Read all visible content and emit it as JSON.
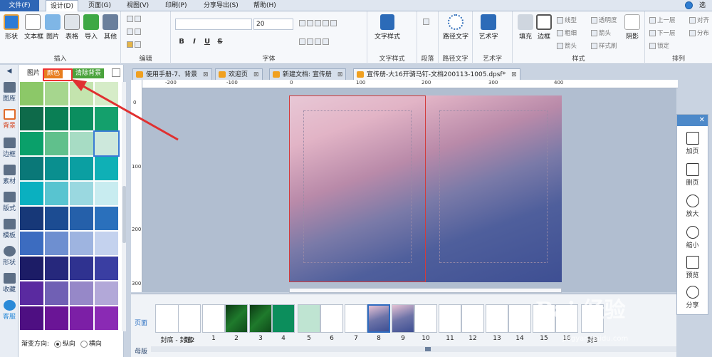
{
  "menu": {
    "file": "文件(F)",
    "items": [
      "设计(D)",
      "页面(G)",
      "视图(V)",
      "印刷(P)",
      "分享导出(S)",
      "帮助(H)"
    ],
    "right": "选项"
  },
  "ribbon": {
    "insert": {
      "buttons": [
        "形状",
        "文本框",
        "图片",
        "表格",
        "导入",
        "其他"
      ],
      "label": "插入"
    },
    "edit": {
      "label": "编辑"
    },
    "font": {
      "size": "20",
      "label": "字体"
    },
    "text_style": {
      "button": "文字样式",
      "label": "文字样式"
    },
    "paragraph": {
      "label": "段落"
    },
    "path_text": {
      "button": "路径文字",
      "label": "路径文字"
    },
    "art_text": {
      "button": "艺术字",
      "label": "艺术字"
    },
    "style": {
      "fill": "填充",
      "border": "边框",
      "options": [
        "线型",
        "粗细",
        "箭头",
        "透明度",
        "箭头",
        "样式刷"
      ],
      "shadow": "阴影",
      "label": "样式"
    },
    "arrange": {
      "options": [
        "上一层",
        "下一层",
        "锁定",
        "对齐",
        "分布"
      ],
      "label": "排列"
    }
  },
  "tools": [
    {
      "label": "图库"
    },
    {
      "label": "背景"
    },
    {
      "label": "边框"
    },
    {
      "label": "素材"
    },
    {
      "label": "版式"
    },
    {
      "label": "模板"
    },
    {
      "label": "形状"
    },
    {
      "label": "收藏"
    },
    {
      "label": "客服"
    }
  ],
  "panel": {
    "tabs": [
      "图片",
      "颜色",
      "清除背景"
    ],
    "gradient_label": "渐变方向:",
    "radio_vertical": "纵向",
    "radio_horizontal": "横向"
  },
  "swatches": [
    [
      "#8cc868",
      "#a6d68e",
      "#c4e4ae",
      "#d6ecc8"
    ],
    [
      "#0e6a4a",
      "#0a7f55",
      "#0b8e5f",
      "#14a06c"
    ],
    [
      "#0aa06a",
      "#60c08c",
      "#a7dcc4",
      "#cde8dc"
    ],
    [
      "#0a7878",
      "#0a8f8f",
      "#0b9fa2",
      "#0fb0b6"
    ],
    [
      "#0ab0c0",
      "#58c4d0",
      "#9ad8e0",
      "#c8ecf0"
    ],
    [
      "#173878",
      "#1c4c92",
      "#2560aa",
      "#2a70bc"
    ],
    [
      "#3c6cc0",
      "#6e8fd0",
      "#9eb4e0",
      "#c4d2ee"
    ],
    [
      "#1c1c66",
      "#26287c",
      "#2f3290",
      "#3a3ea2"
    ],
    [
      "#5a2aa0",
      "#7060b4",
      "#9688c8",
      "#b2a8d8"
    ],
    [
      "#4e0f82",
      "#6a1596",
      "#7c1fa6",
      "#8a2ab4"
    ]
  ],
  "doc_tabs": [
    "使用手册-7、背景",
    "欢迎页",
    "新建文档: 宣传册",
    "宣传册-大16开骑马钉-文档200113-1005.dpsf*"
  ],
  "ruler": {
    "h": [
      "-200",
      "-100",
      "0",
      "100",
      "200",
      "300",
      "400"
    ],
    "v": [
      "0",
      "100",
      "200",
      "300"
    ]
  },
  "right_panel": {
    "items": [
      "加页",
      "删页",
      "放大",
      "缩小",
      "预览",
      "分享"
    ]
  },
  "thumb_tabs": [
    "页面",
    "母版"
  ],
  "thumbs": [
    {
      "caption": "封底 - 封面",
      "kind": "blank"
    },
    {
      "caption": "封2",
      "kind": "blank"
    },
    {
      "caption": "1",
      "kind": "blank"
    },
    {
      "caption": "2",
      "kind": "green"
    },
    {
      "caption": "3",
      "kind": "green"
    },
    {
      "caption": "4",
      "kind": "teal"
    },
    {
      "caption": "5",
      "kind": "mint"
    },
    {
      "caption": "6",
      "kind": "blank"
    },
    {
      "caption": "7",
      "kind": "blank"
    },
    {
      "caption": "8",
      "kind": "purple"
    },
    {
      "caption": "9",
      "kind": "purple"
    },
    {
      "caption": "10",
      "kind": "blank"
    },
    {
      "caption": "11",
      "kind": "blank"
    },
    {
      "caption": "12",
      "kind": "blank"
    },
    {
      "caption": "13",
      "kind": "blank"
    },
    {
      "caption": "14",
      "kind": "blank"
    },
    {
      "caption": "15",
      "kind": "blank"
    },
    {
      "caption": "16",
      "kind": "blank"
    },
    {
      "caption": "封3",
      "kind": "blank"
    }
  ],
  "watermark": {
    "brand": "Bai 经验",
    "url": "jingyan.baidu.com"
  }
}
